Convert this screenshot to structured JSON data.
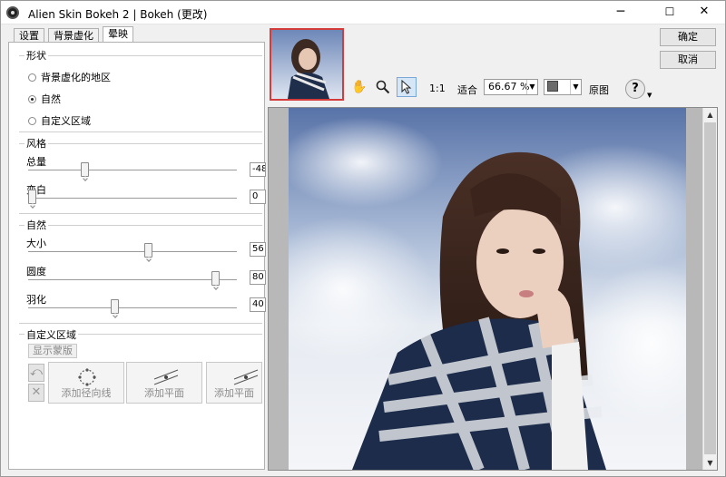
{
  "window": {
    "title": "Alien Skin Bokeh 2 | Bokeh (更改)",
    "min": "─",
    "max": "☐",
    "close": "✕"
  },
  "tabs": [
    "设置",
    "背景虚化",
    "晕映"
  ],
  "shape": {
    "label": "形状",
    "options": [
      "背景虚化的地区",
      "自然",
      "自定义区域"
    ],
    "selected": 1
  },
  "style": {
    "label": "风格",
    "sliders": [
      {
        "label": "总量",
        "value": "-48",
        "fraction": 0.27
      },
      {
        "label": "变白",
        "value": "0",
        "fraction": 0.0
      }
    ]
  },
  "natural": {
    "label": "自然",
    "sliders": [
      {
        "label": "大小",
        "value": "56",
        "fraction": 0.56
      },
      {
        "label": "圆度",
        "value": "80",
        "fraction": 0.89
      },
      {
        "label": "羽化",
        "value": "40",
        "fraction": 0.4
      }
    ]
  },
  "custom": {
    "label": "自定义区域",
    "show_mask": "显示蒙版",
    "buttons": [
      "添加径向线",
      "添加平面",
      "添加平面"
    ]
  },
  "actions": {
    "ok": "确定",
    "cancel": "取消"
  },
  "toolbar": {
    "ratio": "1:1",
    "fit": "适合",
    "zoom": "66.67 %",
    "original": "原图",
    "help": "?"
  }
}
